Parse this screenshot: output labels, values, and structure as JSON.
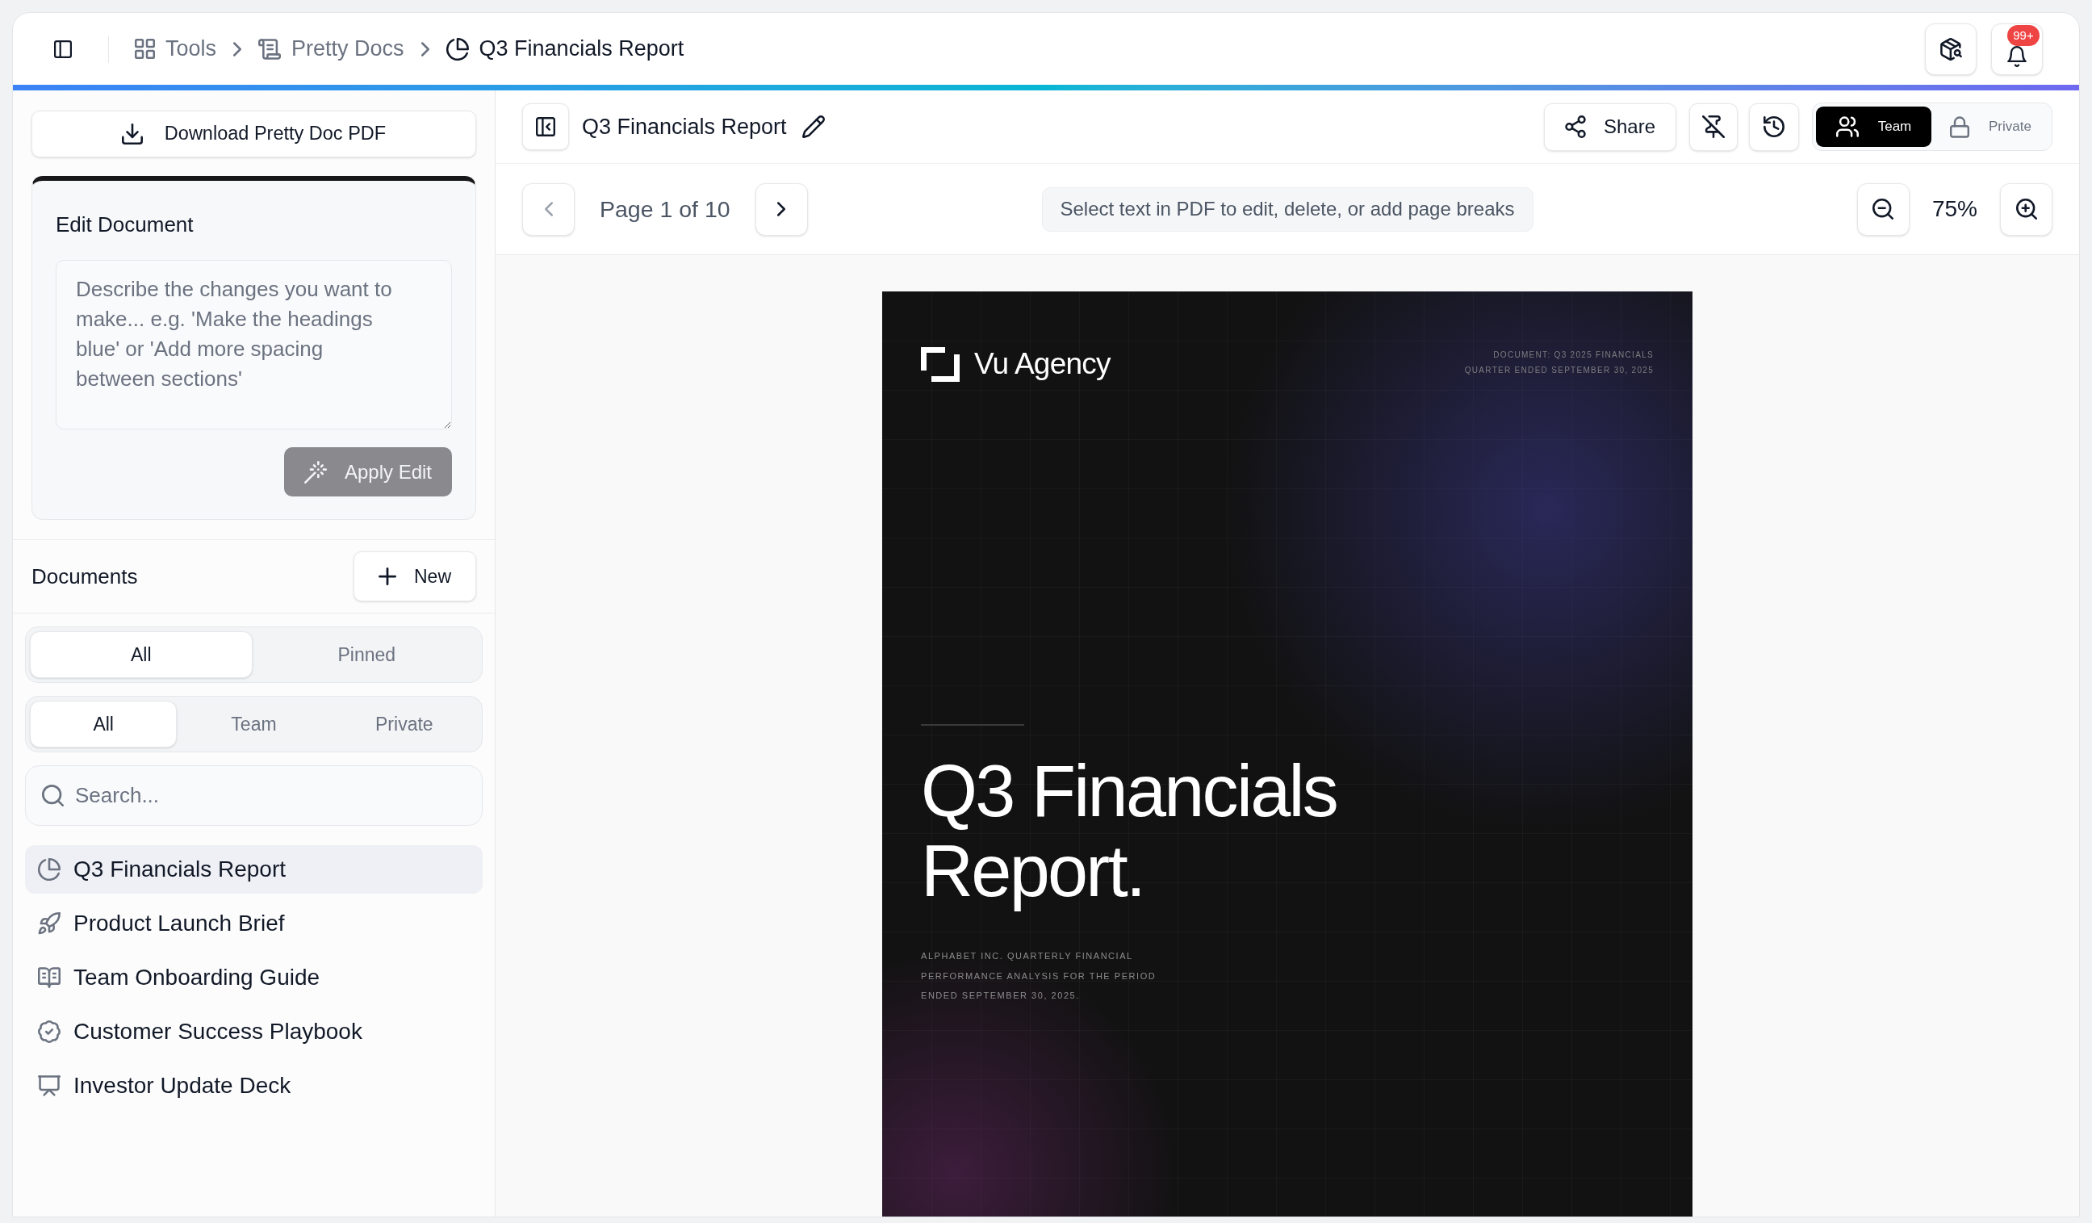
{
  "top_bar": {
    "breadcrumb": [
      {
        "label": "Tools",
        "current": false
      },
      {
        "label": "Pretty Docs",
        "current": false
      },
      {
        "label": "Q3 Financials Report",
        "current": true
      }
    ],
    "notification_badge": "99+"
  },
  "sidebar": {
    "download_button": "Download Pretty Doc PDF",
    "edit_panel": {
      "title": "Edit Document",
      "placeholder": "Describe the changes you want to make... e.g. 'Make the headings blue' or 'Add more spacing between sections'",
      "apply_button": {
        "label": "Apply Edit",
        "disabled": true
      }
    },
    "documents": {
      "title": "Documents",
      "new_button": "New",
      "filter_tabs": [
        {
          "label": "All",
          "selected": true
        },
        {
          "label": "Pinned",
          "selected": false
        }
      ],
      "scope_tabs": [
        {
          "label": "All",
          "selected": true
        },
        {
          "label": "Team",
          "selected": false
        },
        {
          "label": "Private",
          "selected": false
        }
      ],
      "search": {
        "placeholder": "Search..."
      },
      "items": [
        {
          "label": "Q3 Financials Report",
          "selected": true
        },
        {
          "label": "Product Launch Brief",
          "selected": false
        },
        {
          "label": "Team Onboarding Guide",
          "selected": false
        },
        {
          "label": "Customer Success Playbook",
          "selected": false
        },
        {
          "label": "Investor Update Deck",
          "selected": false
        }
      ]
    }
  },
  "document_header": {
    "title": "Q3 Financials Report",
    "share_button": "Share",
    "visibility_tabs": [
      {
        "label": "Team",
        "selected": true
      },
      {
        "label": "Private",
        "selected": false
      }
    ]
  },
  "page_toolbar": {
    "prev_button": {
      "disabled": true
    },
    "page_label": "Page 1 of 10",
    "next_button": {
      "disabled": false
    },
    "hint": "Select text in PDF to edit, delete, or add page breaks",
    "zoom_level": "75%"
  },
  "pdf_page": {
    "brand": "Vu Agency",
    "meta_lines": [
      "DOCUMENT: Q3 2025 FINANCIALS",
      "QUARTER ENDED SEPTEMBER 30, 2025"
    ],
    "title": "Q3 Financials Report.",
    "subtitle": "ALPHABET INC. QUARTERLY FINANCIAL PERFORMANCE ANALYSIS FOR THE PERIOD ENDED SEPTEMBER 30, 2025."
  }
}
